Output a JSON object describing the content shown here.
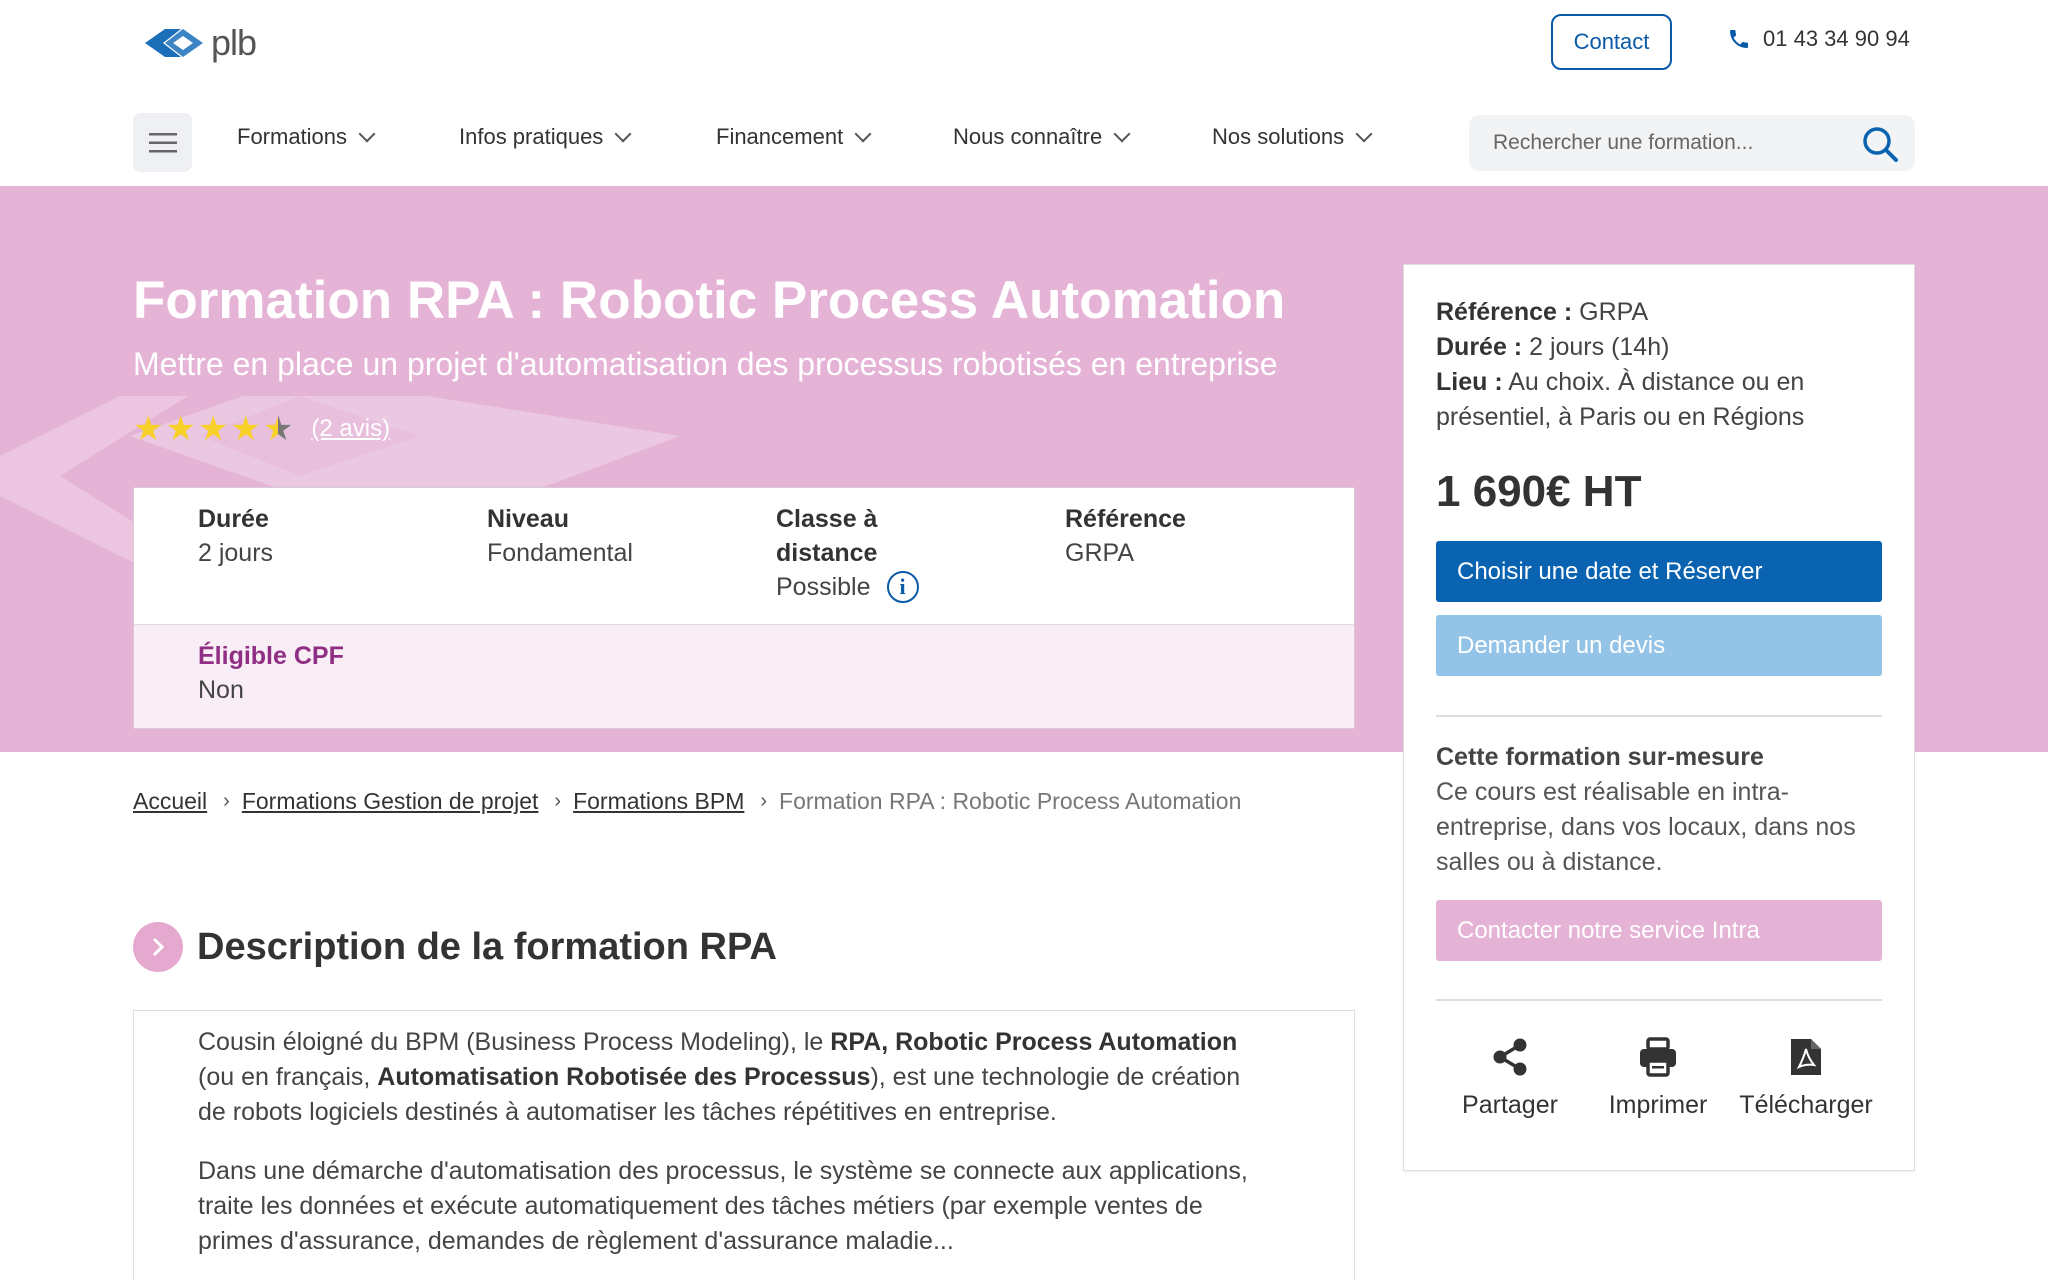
{
  "header": {
    "logo_text": "plb",
    "contact_label": "Contact",
    "phone": "01 43 34 90 94",
    "nav": [
      {
        "label": "Formations"
      },
      {
        "label": "Infos pratiques"
      },
      {
        "label": "Financement"
      },
      {
        "label": "Nous connaître"
      },
      {
        "label": "Nos solutions"
      }
    ],
    "search_placeholder": "Rechercher une formation..."
  },
  "hero": {
    "title": "Formation RPA : Robotic Process Automation",
    "subtitle": "Mettre en place un projet d'automatisation des processus robotisés en entreprise",
    "rating": 4.5,
    "reviews_label": "(2 avis)"
  },
  "info": {
    "duree_label": "Durée",
    "duree_value": "2 jours",
    "niveau_label": "Niveau",
    "niveau_value": "Fondamental",
    "classe_label_1": "Classe à",
    "classe_label_2": "distance",
    "classe_value": "Possible",
    "reference_label": "Référence",
    "reference_value": "GRPA",
    "cpf_label": "Éligible CPF",
    "cpf_value": "Non"
  },
  "sidebar": {
    "ref_label": "Référence :",
    "ref_value": "GRPA",
    "duree_label": "Durée :",
    "duree_value": "2 jours (14h)",
    "lieu_label": "Lieu :",
    "lieu_value_1": "Au choix. À distance ou en",
    "lieu_value_2": "présentiel, à Paris ou en Régions",
    "price": "1 690€ HT",
    "reserve_button": "Choisir une date et Réserver",
    "devis_button": "Demander un devis",
    "intra_title": "Cette formation sur-mesure",
    "intra_text": "Ce cours est réalisable en intra-entreprise, dans vos locaux, dans nos salles ou à distance.",
    "intra_button": "Contacter notre service Intra",
    "actions": [
      {
        "label": "Partager",
        "icon": "share-icon"
      },
      {
        "label": "Imprimer",
        "icon": "printer-icon"
      },
      {
        "label": "Télécharger",
        "icon": "pdf-icon"
      }
    ]
  },
  "breadcrumb": {
    "items": [
      "Accueil",
      "Formations Gestion de projet",
      "Formations BPM"
    ],
    "current": "Formation RPA : Robotic Process Automation"
  },
  "description": {
    "title": "Description de la formation RPA",
    "p1_a": "Cousin éloigné du BPM (Business Process Modeling), le ",
    "p1_b": "RPA, Robotic Process Automation",
    "p1_c": " (ou en français, ",
    "p1_d": "Automatisation Robotisée des Processus",
    "p1_e": "), est une technologie de création de robots logiciels destinés à automatiser les tâches répétitives en entreprise.",
    "p2": "Dans une démarche d'automatisation des processus, le système se connecte aux applications, traite les données et exécute automatiquement des tâches métiers (par exemple ventes de primes d'assurance, demandes de règlement d'assurance maladie..."
  },
  "colors": {
    "brand_blue": "#0a63b0",
    "hero_pink": "#e5b3d6",
    "cpf_purple": "#8f2e84"
  }
}
